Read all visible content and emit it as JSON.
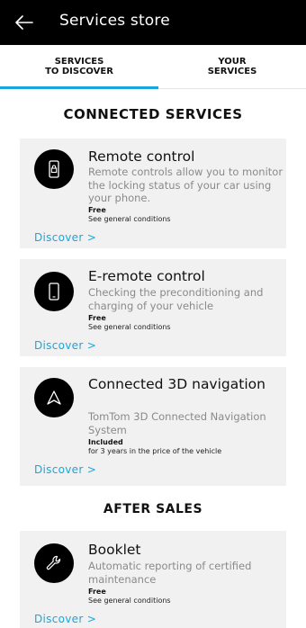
{
  "header": {
    "title": "Services store",
    "back_icon": "arrow-left-icon"
  },
  "tabs": [
    {
      "label": "SERVICES\nTO DISCOVER",
      "active": true
    },
    {
      "label": "YOUR\nSERVICES",
      "active": false
    }
  ],
  "accent_color": "#1aa6dc",
  "sections": {
    "connected": "CONNECTED SERVICES",
    "after_sales": "AFTER SALES"
  },
  "services": [
    {
      "icon": "phone-lock-icon",
      "name": "Remote control",
      "desc": "Remote controls allow you to monitor the locking status of your car using your phone.",
      "price": "Free",
      "condition": "See general conditions",
      "discover": "Discover >"
    },
    {
      "icon": "phone-icon",
      "name": "E-remote control",
      "desc": "Checking the preconditioning and charging of your vehicle",
      "price": "Free",
      "condition": "See general conditions",
      "discover": "Discover >"
    },
    {
      "icon": "navigation-arrow-icon",
      "name": "Connected 3D navigation",
      "desc": "TomTom 3D Connected Navigation System",
      "price": "Included",
      "condition": "for 3 years in the price of the vehicle",
      "discover": "Discover >"
    },
    {
      "icon": "wrench-icon",
      "name": "Booklet",
      "desc": "Automatic reporting of certified maintenance",
      "price": "Free",
      "condition": "See general conditions",
      "discover": "Discover >"
    }
  ]
}
